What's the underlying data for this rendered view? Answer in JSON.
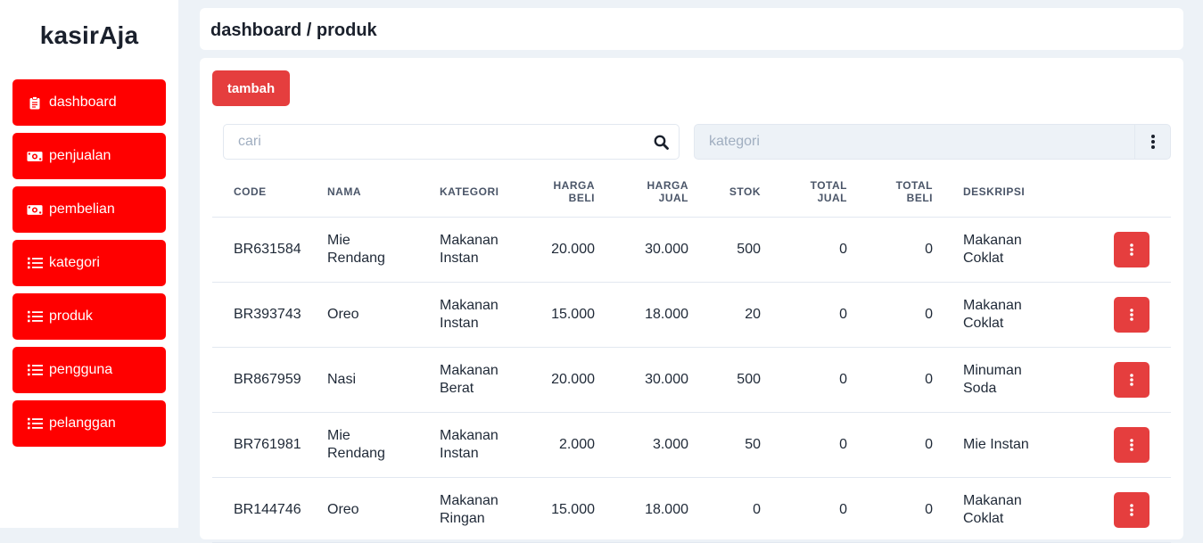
{
  "app": {
    "brand": "kasirAja"
  },
  "sidebar": {
    "items": [
      {
        "label": "dashboard",
        "icon": "clipboard-icon"
      },
      {
        "label": "penjualan",
        "icon": "money-icon"
      },
      {
        "label": "pembelian",
        "icon": "money-icon"
      },
      {
        "label": "kategori",
        "icon": "list-icon"
      },
      {
        "label": "produk",
        "icon": "list-icon"
      },
      {
        "label": "pengguna",
        "icon": "list-icon"
      },
      {
        "label": "pelanggan",
        "icon": "list-icon"
      }
    ]
  },
  "breadcrumb": "dashboard / produk",
  "toolbar": {
    "add_label": "tambah"
  },
  "search": {
    "placeholder": "cari",
    "value": ""
  },
  "category_filter": {
    "placeholder": "kategori",
    "value": ""
  },
  "table": {
    "headers": {
      "code": "CODE",
      "nama": "NAMA",
      "kategori": "KATEGORI",
      "harga_beli": [
        "HARGA",
        "BELI"
      ],
      "harga_jual": [
        "HARGA",
        "JUAL"
      ],
      "stok": "STOK",
      "total_jual": [
        "TOTAL",
        "JUAL"
      ],
      "total_beli": [
        "TOTAL",
        "BELI"
      ],
      "deskripsi": "DESKRIPSI"
    },
    "rows": [
      {
        "code": "BR631584",
        "nama": [
          "Mie",
          "Rendang"
        ],
        "kategori": [
          "Makanan",
          "Instan"
        ],
        "harga_beli": "20.000",
        "harga_jual": "30.000",
        "stok": "500",
        "total_jual": "0",
        "total_beli": "0",
        "deskripsi": [
          "Makanan",
          "Coklat"
        ]
      },
      {
        "code": "BR393743",
        "nama": [
          "Oreo"
        ],
        "kategori": [
          "Makanan",
          "Instan"
        ],
        "harga_beli": "15.000",
        "harga_jual": "18.000",
        "stok": "20",
        "total_jual": "0",
        "total_beli": "0",
        "deskripsi": [
          "Makanan",
          "Coklat"
        ]
      },
      {
        "code": "BR867959",
        "nama": [
          "Nasi"
        ],
        "kategori": [
          "Makanan",
          "Berat"
        ],
        "harga_beli": "20.000",
        "harga_jual": "30.000",
        "stok": "500",
        "total_jual": "0",
        "total_beli": "0",
        "deskripsi": [
          "Minuman",
          "Soda"
        ]
      },
      {
        "code": "BR761981",
        "nama": [
          "Mie",
          "Rendang"
        ],
        "kategori": [
          "Makanan",
          "Instan"
        ],
        "harga_beli": "2.000",
        "harga_jual": "3.000",
        "stok": "50",
        "total_jual": "0",
        "total_beli": "0",
        "deskripsi": [
          "Mie Instan"
        ]
      },
      {
        "code": "BR144746",
        "nama": [
          "Oreo"
        ],
        "kategori": [
          "Makanan",
          "Ringan"
        ],
        "harga_beli": "15.000",
        "harga_jual": "18.000",
        "stok": "0",
        "total_jual": "0",
        "total_beli": "0",
        "deskripsi": [
          "Makanan",
          "Coklat"
        ]
      }
    ]
  },
  "colors": {
    "sidebar_button": "#ff0000",
    "primary_button": "#e53e3e",
    "page_background": "#edf2f7"
  }
}
